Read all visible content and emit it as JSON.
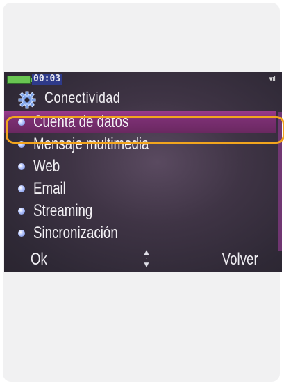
{
  "status_bar": {
    "time": "00:03",
    "battery_color": "#69c552",
    "signal_icon": "signal-bars-icon"
  },
  "header": {
    "icon": "gear-icon",
    "title": "Conectividad"
  },
  "menu": {
    "items": [
      {
        "label": "Cuenta de datos",
        "selected": true
      },
      {
        "label": "Mensaje multimedia",
        "selected": false
      },
      {
        "label": "Web",
        "selected": false
      },
      {
        "label": "Email",
        "selected": false
      },
      {
        "label": "Streaming",
        "selected": false
      },
      {
        "label": "Sincronización",
        "selected": false
      }
    ]
  },
  "softkeys": {
    "left": "Ok",
    "right": "Volver"
  },
  "colors": {
    "highlight_ring": "#f2a51e",
    "selection_bar": "#7a2f72",
    "screen_bg": "#3f3445"
  }
}
